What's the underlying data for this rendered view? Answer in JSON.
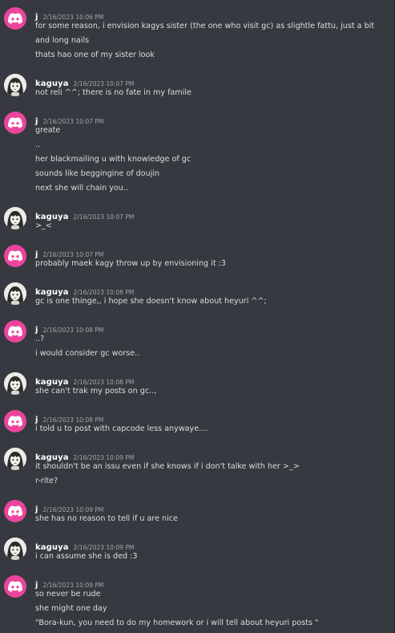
{
  "colors": {
    "background": "#36393f",
    "discord_avatar": "#eb459e",
    "author": "#ffffff",
    "text": "#dcddde",
    "timestamp": "#a3a6aa"
  },
  "messages": [
    {
      "author": "j",
      "avatar": "discord-logo-icon",
      "timestamp": "2/16/2023 10:06 PM",
      "lines": [
        "for some reason, i envision kagys sister (the one who visit gc) as slightle fattu, just a bit",
        "and long nails",
        "thats hao one of my sister look"
      ]
    },
    {
      "author": "kaguya",
      "avatar": "kaguya-avatar-icon",
      "timestamp": "2/16/2023 10:07 PM",
      "lines": [
        "not reli ^^; there is no fate in my famile"
      ]
    },
    {
      "author": "j",
      "avatar": "discord-logo-icon",
      "timestamp": "2/16/2023 10:07 PM",
      "lines": [
        "greate",
        "..",
        "her blackmailing u with knowledge of gc",
        "sounds like beggingine of doujin",
        "next she will chain you.."
      ]
    },
    {
      "author": "kaguya",
      "avatar": "kaguya-avatar-icon",
      "timestamp": "2/16/2023 10:07 PM",
      "lines": [
        ">_<"
      ]
    },
    {
      "author": "j",
      "avatar": "discord-logo-icon",
      "timestamp": "2/16/2023 10:07 PM",
      "lines": [
        "probably maek kagy throw up by envisioning it :3"
      ]
    },
    {
      "author": "kaguya",
      "avatar": "kaguya-avatar-icon",
      "timestamp": "2/16/2023 10:08 PM",
      "lines": [
        "gc is one thinge,, i hope she doesn't know about heyuri ^^;"
      ]
    },
    {
      "author": "j",
      "avatar": "discord-logo-icon",
      "timestamp": "2/16/2023 10:08 PM",
      "lines": [
        "..?",
        "i would consider gc worse.."
      ]
    },
    {
      "author": "kaguya",
      "avatar": "kaguya-avatar-icon",
      "timestamp": "2/16/2023 10:08 PM",
      "lines": [
        "she can't trak my posts on gc..,"
      ]
    },
    {
      "author": "j",
      "avatar": "discord-logo-icon",
      "timestamp": "2/16/2023 10:08 PM",
      "lines": [
        "i told u to post with capcode less anywaye...."
      ]
    },
    {
      "author": "kaguya",
      "avatar": "kaguya-avatar-icon",
      "timestamp": "2/16/2023 10:09 PM",
      "lines": [
        "it shouldn't be an issu even if she knows if i don't talke with her >_>",
        "r-rite?"
      ]
    },
    {
      "author": "j",
      "avatar": "discord-logo-icon",
      "timestamp": "2/16/2023 10:09 PM",
      "lines": [
        "she has no reason to tell if u are nice"
      ]
    },
    {
      "author": "kaguya",
      "avatar": "kaguya-avatar-icon",
      "timestamp": "2/16/2023 10:09 PM",
      "lines": [
        "i can assume she is ded :3"
      ]
    },
    {
      "author": "j",
      "avatar": "discord-logo-icon",
      "timestamp": "2/16/2023 10:09 PM",
      "lines": [
        "so never be rude",
        "she might one day",
        "\"Bora-kun, you need to do my homework or i will tell about heyuri posts \""
      ]
    }
  ]
}
